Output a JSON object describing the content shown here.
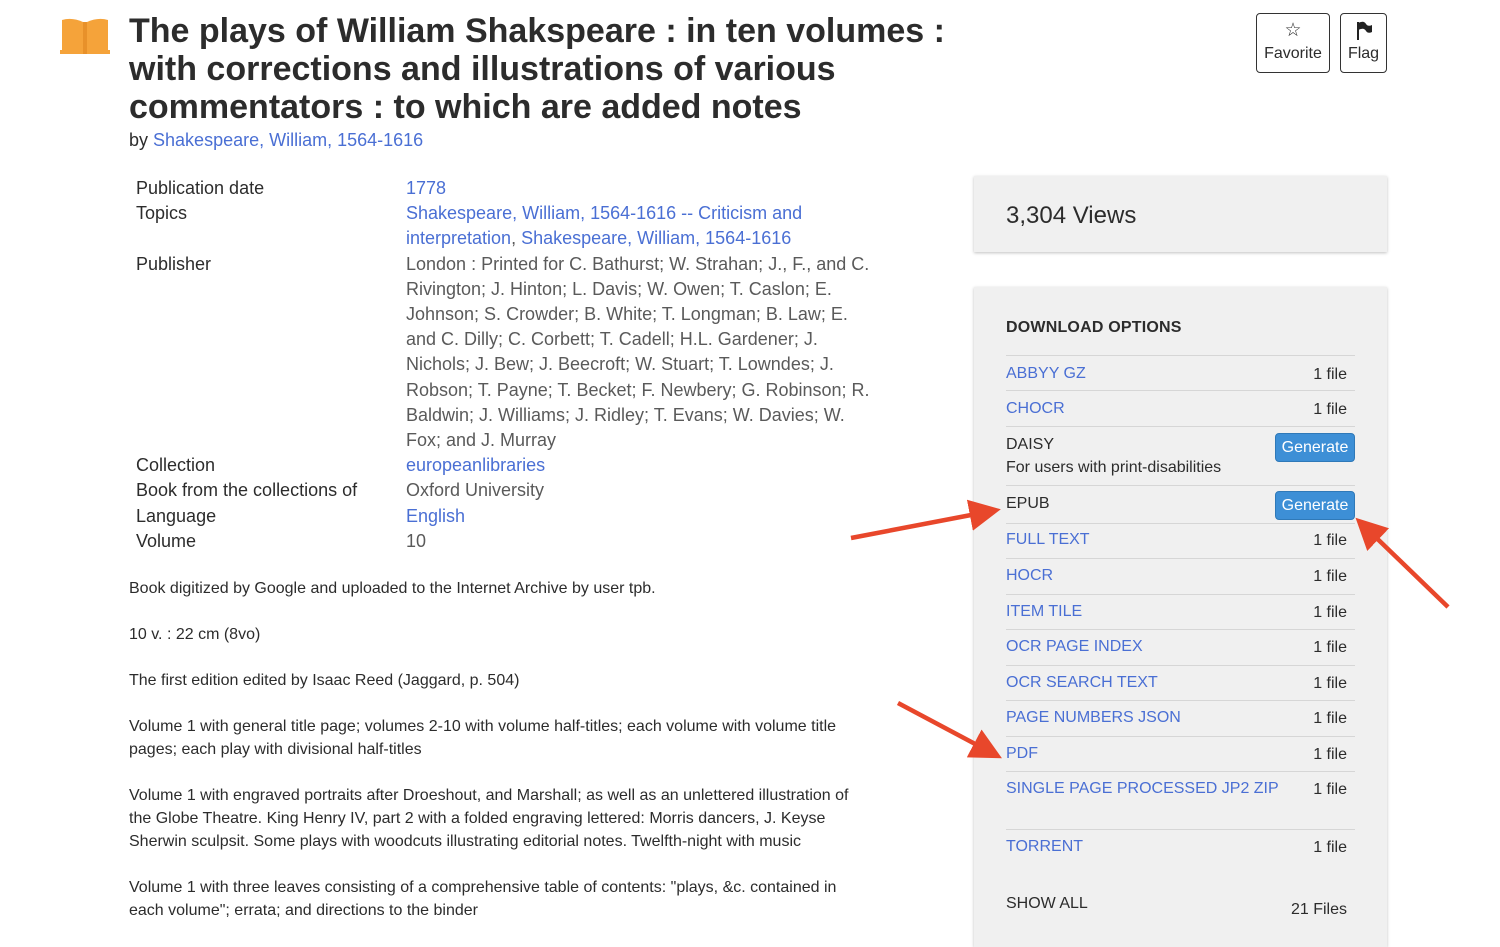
{
  "header": {
    "title": "The plays of William Shakspeare : in ten volumes : with corrections and illustrations of various commentators : to which are added notes",
    "by_label": "by",
    "author": "Shakespeare, William, 1564-1616",
    "favorite_label": "Favorite",
    "flag_label": "Flag"
  },
  "metadata": {
    "publication_date": {
      "key": "Publication date",
      "value": "1778"
    },
    "topics": {
      "key": "Topics",
      "value1": "Shakespeare, William, 1564-1616 -- Criticism and interpretation",
      "sep": ", ",
      "value2": "Shakespeare, William, 1564-1616"
    },
    "publisher": {
      "key": "Publisher",
      "value": "London : Printed for C. Bathurst; W. Strahan; J., F., and C. Rivington; J. Hinton; L. Davis; W. Owen; T. Caslon; E. Johnson; S. Crowder; B. White; T. Longman; B. Law; E. and C. Dilly; C. Corbett; T. Cadell; H.L. Gardener; J. Nichols; J. Bew; J. Beecroft; W. Stuart; T. Lowndes; J. Robson; T. Payne; T. Becket; F. Newbery; G. Robinson; R. Baldwin; J. Williams; J. Ridley; T. Evans; W. Davies; W. Fox; and J. Murray"
    },
    "collection": {
      "key": "Collection",
      "value": "europeanlibraries"
    },
    "book_from": {
      "key": "Book from the collections of",
      "value": "Oxford University"
    },
    "language": {
      "key": "Language",
      "value": "English"
    },
    "volume": {
      "key": "Volume",
      "value": "10"
    }
  },
  "description": [
    "Book digitized by Google and uploaded to the Internet Archive by user tpb.",
    "10 v. : 22 cm (8vo)",
    "The first edition edited by Isaac Reed (Jaggard, p. 504)",
    "Volume 1 with general title page; volumes 2-10 with volume half-titles; each volume with volume title pages; each play with divisional half-titles",
    "Volume 1 with engraved portraits after Droeshout, and Marshall; as well as an unlettered illustration of the Globe Theatre. King Henry IV, part 2 with a folded engraving lettered: Morris dancers, J. Keyse Sherwin sculpsit. Some plays with woodcuts illustrating editorial notes. Twelfth-night with music",
    "Volume 1 with three leaves consisting of a comprehensive table of contents: \"plays, &c. contained in each volume\"; errata; and directions to the binder"
  ],
  "stats": {
    "views": "3,304 Views"
  },
  "downloads": {
    "heading": "DOWNLOAD OPTIONS",
    "items": [
      {
        "name": "ABBYY GZ",
        "count": "1 file"
      },
      {
        "name": "CHOCR",
        "count": "1 file"
      },
      {
        "name": "DAISY",
        "sub": "For users with print-disabilities",
        "button": "Generate"
      },
      {
        "name": "EPUB",
        "button": "Generate"
      },
      {
        "name": "FULL TEXT",
        "count": "1 file"
      },
      {
        "name": "HOCR",
        "count": "1 file"
      },
      {
        "name": "ITEM TILE",
        "count": "1 file"
      },
      {
        "name": "OCR PAGE INDEX",
        "count": "1 file"
      },
      {
        "name": "OCR SEARCH TEXT",
        "count": "1 file"
      },
      {
        "name": "PAGE NUMBERS JSON",
        "count": "1 file"
      },
      {
        "name": "PDF",
        "count": "1 file"
      },
      {
        "name": "SINGLE PAGE PROCESSED JP2 ZIP",
        "count": "1 file"
      },
      {
        "name": "TORRENT",
        "count": "1 file"
      }
    ],
    "show_all": "SHOW ALL",
    "total": "21 Files"
  },
  "colors": {
    "link": "#4a6fd4",
    "button": "#3d8fd6",
    "arrow": "#e8472b",
    "icon": "#f5a33a"
  }
}
